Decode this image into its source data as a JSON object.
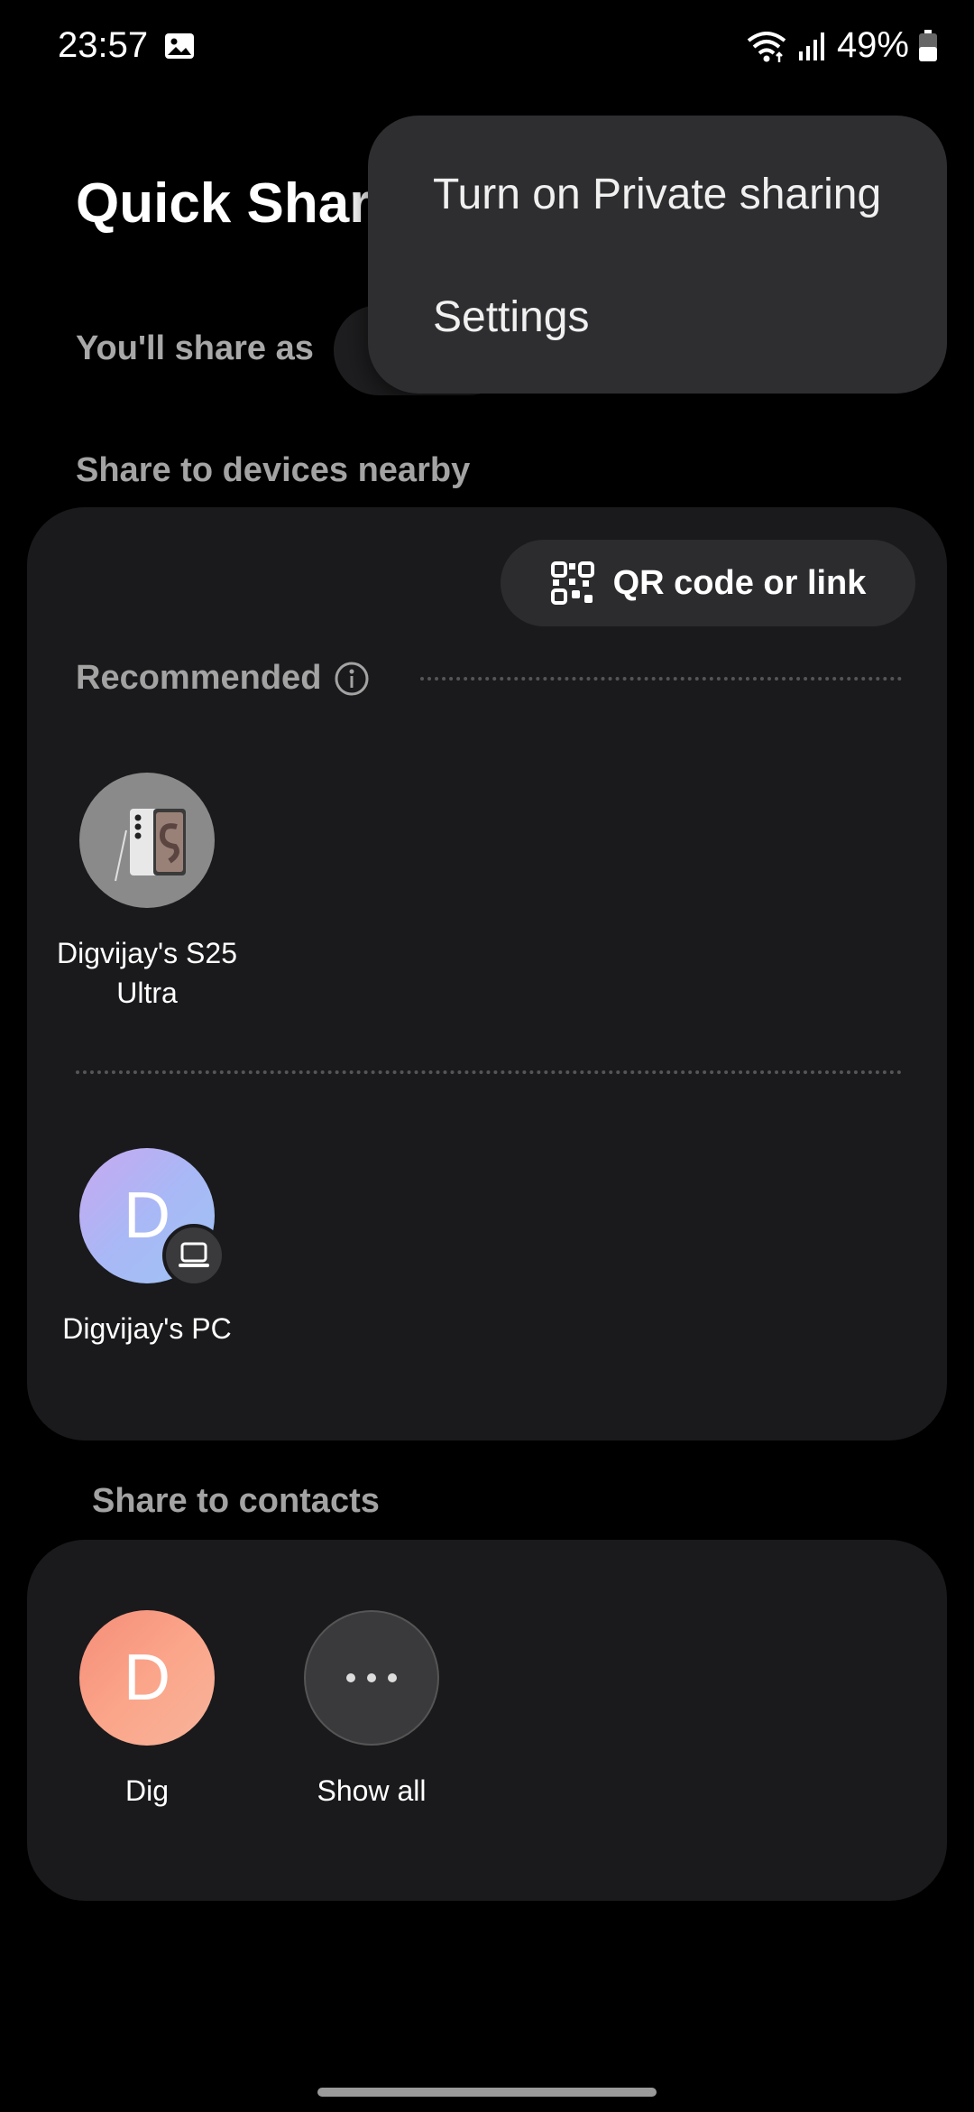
{
  "status_bar": {
    "time": "23:57",
    "battery": "49%",
    "icons": [
      "gallery-icon",
      "wifi-icon",
      "signal-icon",
      "battery-icon"
    ]
  },
  "header": {
    "title": "Quick Share",
    "share_as_label": "You'll share as"
  },
  "menu": {
    "items": [
      {
        "label": "Turn on Private sharing"
      },
      {
        "label": "Settings"
      }
    ]
  },
  "nearby": {
    "section_label": "Share to devices nearby",
    "qr_button_label": "QR code or link",
    "recommended_label": "Recommended",
    "recommended_devices": [
      {
        "name": "Digvijay's S25 Ultra",
        "icon": "phone-icon"
      }
    ],
    "other_devices": [
      {
        "name": "Digvijay's PC",
        "initial": "D",
        "icon": "laptop-icon"
      }
    ]
  },
  "contacts": {
    "section_label": "Share to contacts",
    "items": [
      {
        "name": "Dig",
        "initial": "D"
      },
      {
        "name": "Show all",
        "icon": "more-icon"
      }
    ]
  },
  "colors": {
    "background": "#000000",
    "card": "#1a1a1c",
    "menu": "#2e2e31",
    "muted_text": "#a3a3a3"
  }
}
